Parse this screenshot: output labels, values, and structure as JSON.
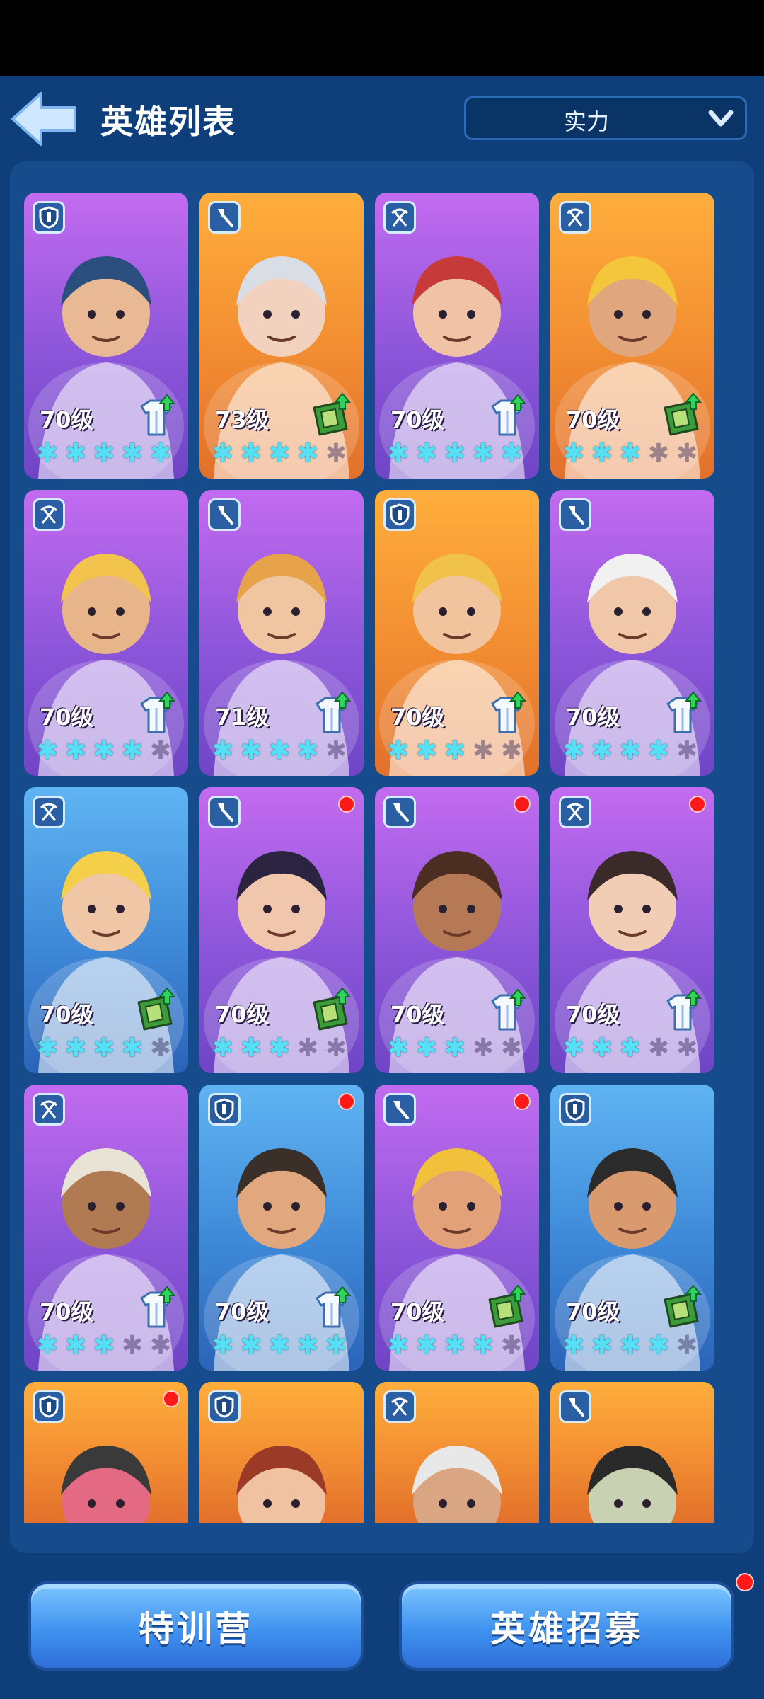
{
  "header": {
    "title": "英雄列表",
    "sort": {
      "selected": "实力"
    }
  },
  "heroes": [
    {
      "level": "70级",
      "stars": 5,
      "role": "shield-icon",
      "bg": "purple",
      "item": "shirt-upgrade-icon",
      "notify": false,
      "skin": "#e9b894",
      "hair": "#2a4f7e"
    },
    {
      "level": "73级",
      "stars": 4,
      "role": "shovel-icon",
      "bg": "orange",
      "item": "book-upgrade-icon",
      "notify": false,
      "skin": "#f2d2bf",
      "hair": "#d9dde6"
    },
    {
      "level": "70级",
      "stars": 5,
      "role": "crossbow-icon",
      "bg": "purple",
      "item": "shirt-upgrade-icon",
      "notify": false,
      "skin": "#f0c3a6",
      "hair": "#c73a3a"
    },
    {
      "level": "70级",
      "stars": 3,
      "role": "crossbow-icon",
      "bg": "orange",
      "item": "book-upgrade-icon",
      "notify": false,
      "skin": "#e0a77e",
      "hair": "#f3c63b"
    },
    {
      "level": "70级",
      "stars": 4,
      "role": "crossbow-icon",
      "bg": "purple",
      "item": "shirt-upgrade-icon",
      "notify": false,
      "skin": "#e8b48a",
      "hair": "#f2c44e"
    },
    {
      "level": "71级",
      "stars": 4,
      "role": "shovel-icon",
      "bg": "purple",
      "item": "shirt-upgrade-icon",
      "notify": false,
      "skin": "#f0c6a2",
      "hair": "#e7a34a"
    },
    {
      "level": "70级",
      "stars": 3,
      "role": "shield-icon",
      "bg": "orange",
      "item": "shirt-upgrade-icon",
      "notify": false,
      "skin": "#f1c49d",
      "hair": "#f1c24a"
    },
    {
      "level": "70级",
      "stars": 4,
      "role": "shovel-icon",
      "bg": "purple",
      "item": "shirt-upgrade-icon",
      "notify": false,
      "skin": "#f0c7a8",
      "hair": "#f1f1f1"
    },
    {
      "level": "70级",
      "stars": 4,
      "role": "crossbow-icon",
      "bg": "blue",
      "item": "book-upgrade-icon",
      "notify": false,
      "skin": "#efc6a6",
      "hair": "#f4cf4a"
    },
    {
      "level": "70级",
      "stars": 3,
      "role": "shovel-icon",
      "bg": "purple",
      "item": "book-upgrade-icon",
      "notify": true,
      "skin": "#f0c6ad",
      "hair": "#2b2440"
    },
    {
      "level": "70级",
      "stars": 3,
      "role": "shovel-icon",
      "bg": "purple",
      "item": "shirt-upgrade-icon",
      "notify": true,
      "skin": "#b57a55",
      "hair": "#4b2e21"
    },
    {
      "level": "70级",
      "stars": 3,
      "role": "crossbow-icon",
      "bg": "purple",
      "item": "shirt-upgrade-icon",
      "notify": true,
      "skin": "#f2cdb6",
      "hair": "#3a2a2a"
    },
    {
      "level": "70级",
      "stars": 3,
      "role": "crossbow-icon",
      "bg": "purple",
      "item": "shirt-upgrade-icon",
      "notify": false,
      "skin": "#b07a52",
      "hair": "#e9e3d6"
    },
    {
      "level": "70级",
      "stars": 5,
      "role": "shield-icon",
      "bg": "blue",
      "item": "shirt-upgrade-icon",
      "notify": true,
      "skin": "#e1a77f",
      "hair": "#3b2f2a"
    },
    {
      "level": "70级",
      "stars": 4,
      "role": "shovel-icon",
      "bg": "purple",
      "item": "book-upgrade-icon",
      "notify": true,
      "skin": "#e3a17a",
      "hair": "#f1c13b"
    },
    {
      "level": "70级",
      "stars": 4,
      "role": "shield-icon",
      "bg": "blue",
      "item": "book-upgrade-icon",
      "notify": false,
      "skin": "#d99a70",
      "hair": "#2b2b2b"
    },
    {
      "role": "shield-icon",
      "bg": "orange",
      "notify": true,
      "skin": "#e46a83",
      "hair": "#3a3a3a"
    },
    {
      "role": "shield-icon",
      "bg": "orange",
      "notify": false,
      "skin": "#f0c2a2",
      "hair": "#9b3a27"
    },
    {
      "role": "crossbow-icon",
      "bg": "orange",
      "notify": false,
      "skin": "#d9a582",
      "hair": "#e8e8e8"
    },
    {
      "role": "shovel-icon",
      "bg": "orange",
      "notify": false,
      "skin": "#c9d1b3",
      "hair": "#2a2a2a"
    }
  ],
  "footer": {
    "training_label": "特训营",
    "recruit_label": "英雄招募",
    "recruit_notify": true
  }
}
